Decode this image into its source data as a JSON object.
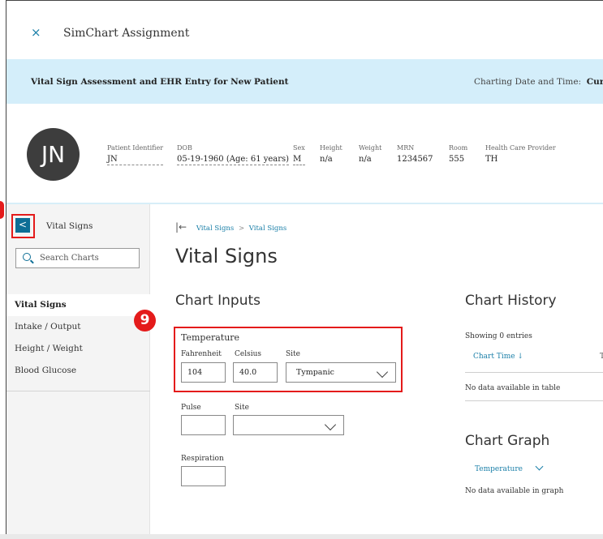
{
  "topbar": {
    "close_icon": "×",
    "title": "SimChart Assignment"
  },
  "banner": {
    "title": "Vital Sign Assessment and EHR Entry for New Patient",
    "charting_label": "Charting Date and Time:",
    "charting_value": "Current D"
  },
  "patient": {
    "initials": "JN",
    "fields": {
      "identifier": {
        "label": "Patient Identifier",
        "value": "JN"
      },
      "dob": {
        "label": "DOB",
        "value": "05-19-1960 (Age: 61 years)"
      },
      "sex": {
        "label": "Sex",
        "value": "M"
      },
      "height": {
        "label": "Height",
        "value": "n/a"
      },
      "weight": {
        "label": "Weight",
        "value": "n/a"
      },
      "mrn": {
        "label": "MRN",
        "value": "1234567"
      },
      "room": {
        "label": "Room",
        "value": "555"
      },
      "provider": {
        "label": "Health Care Provider",
        "value": "TH"
      }
    }
  },
  "sidebar": {
    "back_icon": "<",
    "title": "Vital Signs",
    "search_placeholder": "Search Charts",
    "items": [
      {
        "label": "Vital Signs",
        "active": true
      },
      {
        "label": "Intake / Output"
      },
      {
        "label": "Height / Weight"
      },
      {
        "label": "Blood Glucose"
      }
    ]
  },
  "main": {
    "back_arrow": "|←",
    "breadcrumb": [
      "Vital Signs",
      "Vital Signs"
    ],
    "page_title": "Vital Signs",
    "chart_inputs": {
      "heading": "Chart Inputs",
      "temperature": {
        "label": "Temperature",
        "fahrenheit_label": "Fahrenheit",
        "fahrenheit_value": "104",
        "celsius_label": "Celsius",
        "celsius_value": "40.0",
        "site_label": "Site",
        "site_value": "Tympanic"
      },
      "pulse": {
        "label": "Pulse",
        "site_label": "Site",
        "value": "",
        "site_value": ""
      },
      "respiration": {
        "label": "Respiration",
        "value": ""
      }
    },
    "chart_history": {
      "heading": "Chart History",
      "showing": "Showing 0 entries",
      "column_chart_time": "Chart Time ↓",
      "column_next": "T",
      "empty": "No data available in table"
    },
    "chart_graph": {
      "heading": "Chart Graph",
      "selected": "Temperature",
      "empty": "No data available in graph"
    }
  },
  "annotation": {
    "step": "9"
  },
  "colors": {
    "accent": "#1a7fa8",
    "banner": "#d4eefa",
    "highlight": "#e41b1b",
    "button": "#0d6e96"
  }
}
